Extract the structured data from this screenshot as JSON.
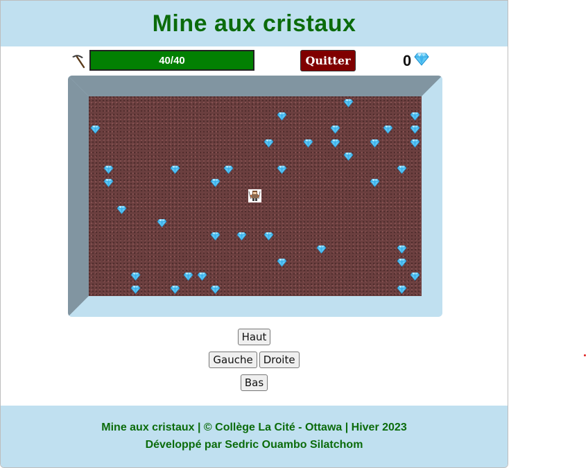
{
  "app": {
    "title": "Mine aux cristaux",
    "brand_color": "#0b6b0b",
    "panel_color": "#c0e0f0"
  },
  "hud": {
    "pick_icon": "pickaxe-icon",
    "energy_text": "40/40",
    "energy_current": 40,
    "energy_max": 40,
    "energy_color": "#028002",
    "quit_label": "Quitter",
    "quit_color": "#800000",
    "crystal_count": "0",
    "crystal_icon": "diamond-icon"
  },
  "board": {
    "columns": 25,
    "rows": 15,
    "ground": "cobblestone",
    "ground_color": "#6b3f3f",
    "player": {
      "col": 12,
      "row": 7,
      "icon": "miner-icon"
    },
    "crystals": [
      [
        19,
        0
      ],
      [
        14,
        1
      ],
      [
        24,
        1
      ],
      [
        0,
        2
      ],
      [
        18,
        2
      ],
      [
        22,
        2
      ],
      [
        24,
        2
      ],
      [
        13,
        3
      ],
      [
        16,
        3
      ],
      [
        18,
        3
      ],
      [
        21,
        3
      ],
      [
        24,
        3
      ],
      [
        19,
        4
      ],
      [
        1,
        5
      ],
      [
        6,
        5
      ],
      [
        10,
        5
      ],
      [
        14,
        5
      ],
      [
        23,
        5
      ],
      [
        1,
        6
      ],
      [
        9,
        6
      ],
      [
        21,
        6
      ],
      [
        2,
        8
      ],
      [
        5,
        9
      ],
      [
        9,
        10
      ],
      [
        11,
        10
      ],
      [
        13,
        10
      ],
      [
        17,
        11
      ],
      [
        23,
        11
      ],
      [
        14,
        12
      ],
      [
        23,
        12
      ],
      [
        3,
        13
      ],
      [
        7,
        13
      ],
      [
        8,
        13
      ],
      [
        24,
        13
      ],
      [
        3,
        14
      ],
      [
        6,
        14
      ],
      [
        9,
        14
      ],
      [
        23,
        14
      ]
    ]
  },
  "controls": {
    "up": "Haut",
    "left": "Gauche",
    "right": "Droite",
    "down": "Bas"
  },
  "footer": {
    "line1": "Mine aux cristaux | © Collège La Cité - Ottawa | Hiver 2023",
    "line2": "Développé par Sedric Ouambo Silatchom"
  }
}
